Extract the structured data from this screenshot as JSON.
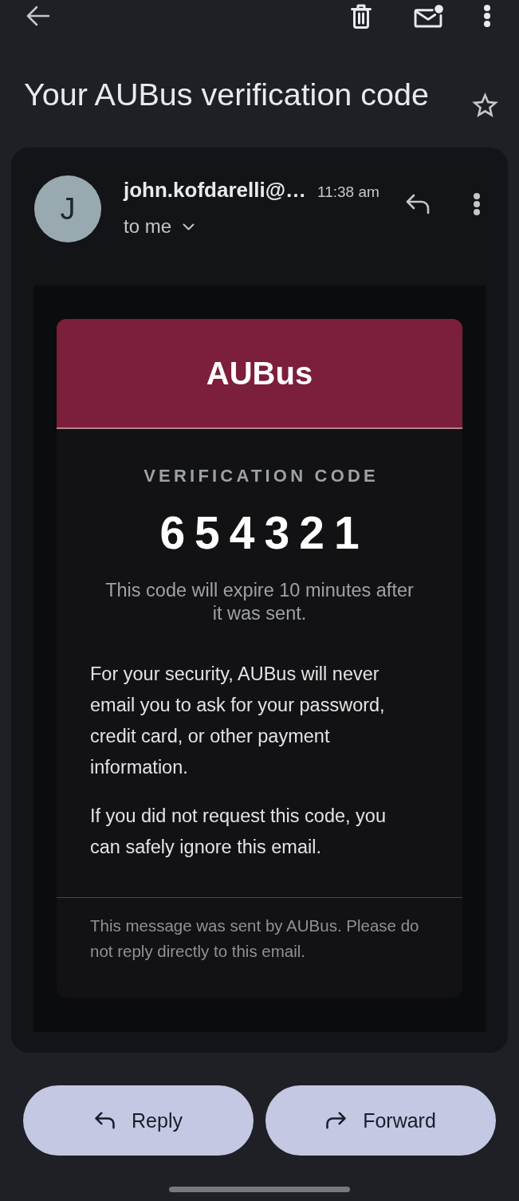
{
  "subject": {
    "title": "Your AUBus verification code",
    "starred": false
  },
  "message": {
    "sender": {
      "initial": "J",
      "name": "john.kofdarelli@…"
    },
    "time": "11:38 am",
    "recipient": "to me",
    "email": {
      "brand": "AUBus",
      "code_label": "VERIFICATION CODE",
      "code": "654321",
      "expiry_note": "This code will expire 10 minutes after it was sent.",
      "paragraphs": [
        "For your security, AUBus will never email you to ask for your password, credit card, or other payment information.",
        "If you did not request this code, you can safely ignore this email."
      ],
      "footer": "This message was sent by AUBus. Please do not reply directly to this email."
    }
  },
  "actions": [
    {
      "kind": "reply",
      "label": "Reply"
    },
    {
      "kind": "forward",
      "label": "Forward"
    }
  ]
}
